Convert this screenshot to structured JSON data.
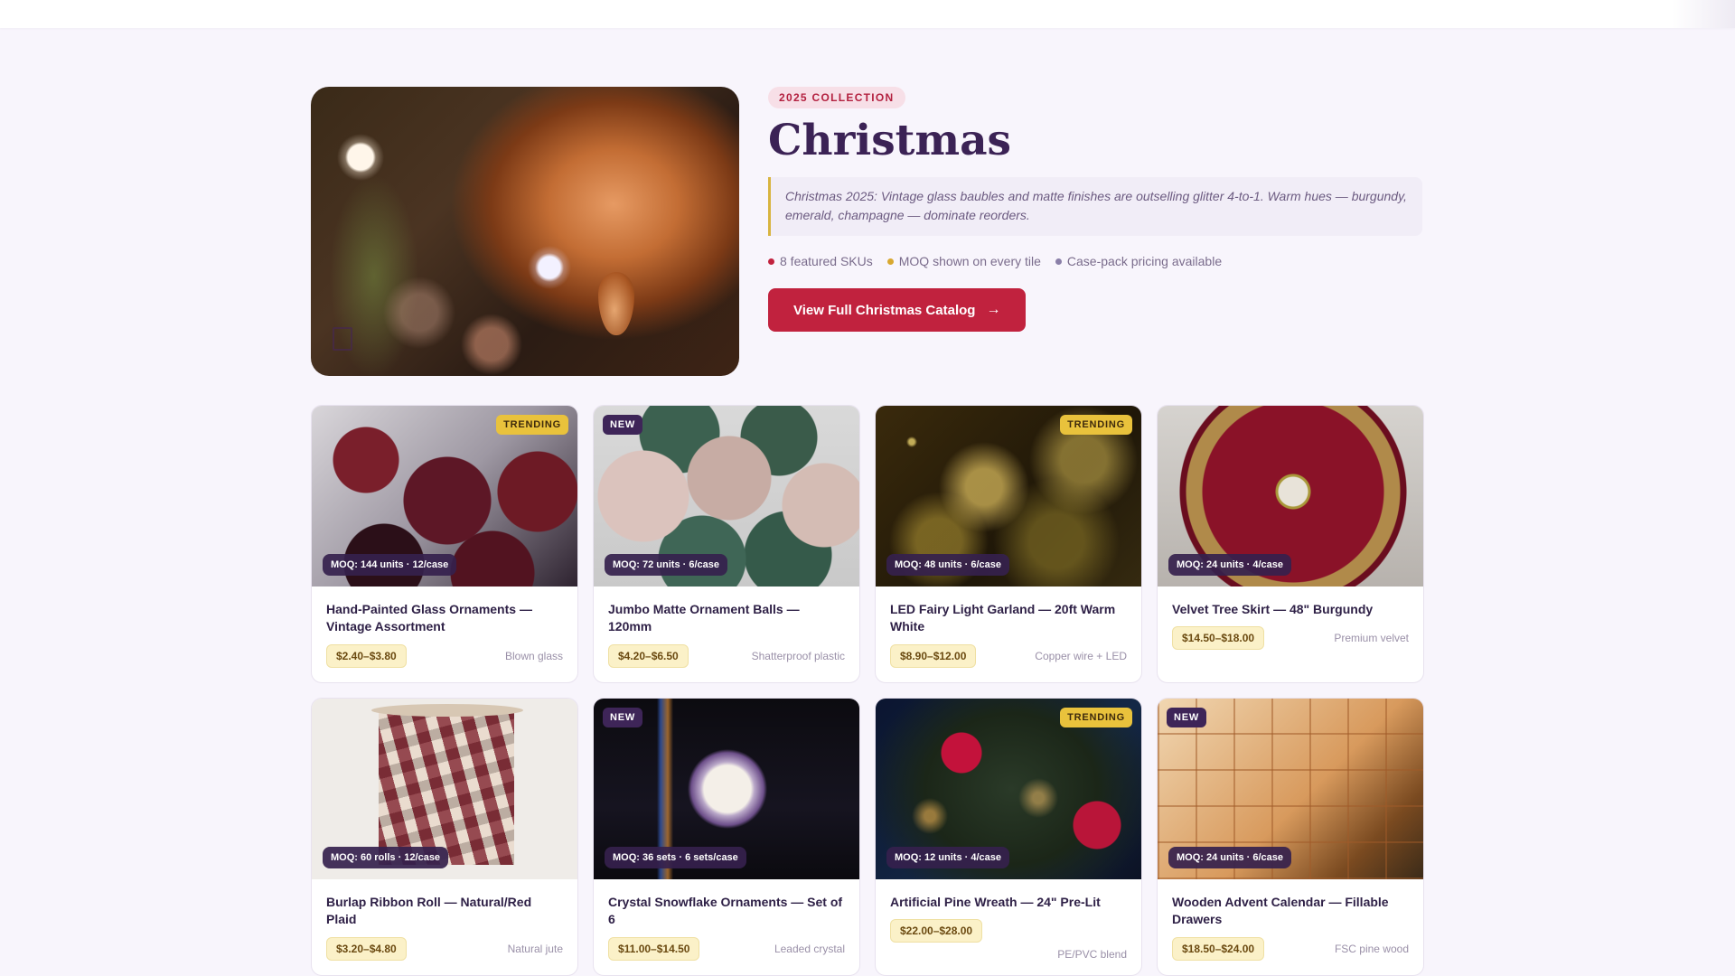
{
  "hero": {
    "badge": "2025 COLLECTION",
    "title": "Christmas",
    "quote": "Christmas 2025: Vintage glass baubles and matte finishes are outselling glitter 4-to-1. Warm hues — burgundy, emerald, champagne — dominate reorders.",
    "stats": [
      {
        "label": "8 featured SKUs",
        "color": "#c1223e"
      },
      {
        "label": "MOQ shown on every tile",
        "color": "#d8a830"
      },
      {
        "label": "Case-pack pricing available",
        "color": "#8a7fa8"
      }
    ],
    "cta_label": "View Full Christmas Catalog",
    "cta_icon": "arrow-right-icon"
  },
  "products": [
    {
      "tag": "TRENDING",
      "moq": "MOQ: 144 units · 12/case",
      "title": "Hand-Painted Glass Ornaments — Vintage Assortment",
      "price": "$2.40–$3.80",
      "material": "Blown glass"
    },
    {
      "tag": "NEW",
      "moq": "MOQ: 72 units · 6/case",
      "title": "Jumbo Matte Ornament Balls — 120mm",
      "price": "$4.20–$6.50",
      "material": "Shatterproof plastic"
    },
    {
      "tag": "TRENDING",
      "moq": "MOQ: 48 units · 6/case",
      "title": "LED Fairy Light Garland — 20ft Warm White",
      "price": "$8.90–$12.00",
      "material": "Copper wire + LED"
    },
    {
      "tag": "",
      "moq": "MOQ: 24 units · 4/case",
      "title": "Velvet Tree Skirt — 48\" Burgundy",
      "price": "$14.50–$18.00",
      "material": "Premium velvet"
    },
    {
      "tag": "",
      "moq": "MOQ: 60 rolls · 12/case",
      "title": "Burlap Ribbon Roll — Natural/Red Plaid",
      "price": "$3.20–$4.80",
      "material": "Natural jute"
    },
    {
      "tag": "NEW",
      "moq": "MOQ: 36 sets · 6 sets/case",
      "title": "Crystal Snowflake Ornaments — Set of 6",
      "price": "$11.00–$14.50",
      "material": "Leaded crystal"
    },
    {
      "tag": "TRENDING",
      "moq": "MOQ: 12 units · 4/case",
      "title": "Artificial Pine Wreath — 24\" Pre-Lit",
      "price": "$22.00–$28.00",
      "material": "PE/PVC blend"
    },
    {
      "tag": "NEW",
      "moq": "MOQ: 24 units · 6/case",
      "title": "Wooden Advent Calendar — Fillable Drawers",
      "price": "$18.50–$24.00",
      "material": "FSC pine wood"
    }
  ],
  "colors": {
    "accent": "#c1223e",
    "trending": "#e9c23c",
    "new": "#3e2558",
    "title": "#3b2255"
  }
}
